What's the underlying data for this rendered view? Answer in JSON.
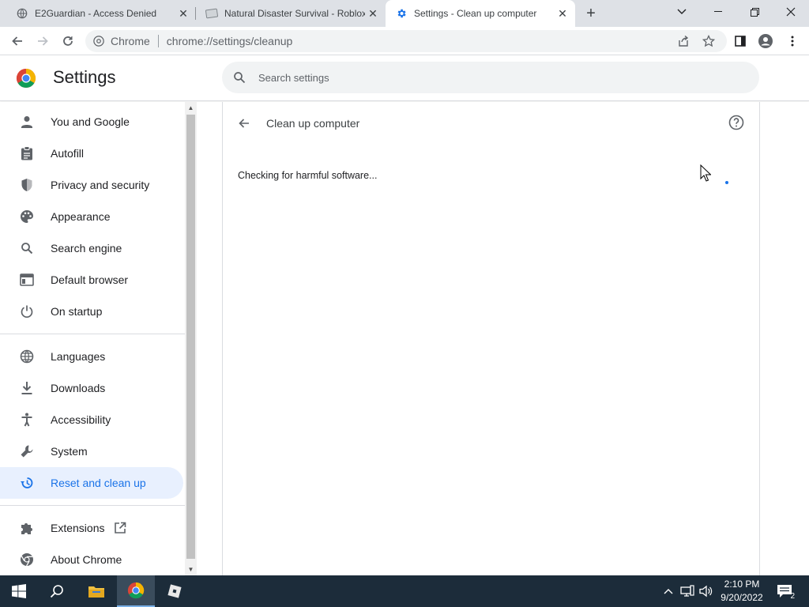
{
  "tabs": [
    {
      "title": "E2Guardian - Access Denied",
      "icon": "globe-icon",
      "active": false
    },
    {
      "title": "Natural Disaster Survival - Roblox",
      "icon": "page-icon",
      "active": false
    },
    {
      "title": "Settings - Clean up computer",
      "icon": "gear-icon",
      "active": true
    }
  ],
  "omnibox": {
    "chip": "Chrome",
    "url": "chrome://settings/cleanup"
  },
  "settings": {
    "title": "Settings",
    "search_placeholder": "Search settings"
  },
  "sidebar": {
    "items": [
      {
        "label": "You and Google",
        "icon": "person-icon"
      },
      {
        "label": "Autofill",
        "icon": "clipboard-icon"
      },
      {
        "label": "Privacy and security",
        "icon": "shield-icon"
      },
      {
        "label": "Appearance",
        "icon": "palette-icon"
      },
      {
        "label": "Search engine",
        "icon": "search-icon"
      },
      {
        "label": "Default browser",
        "icon": "browser-icon"
      },
      {
        "label": "On startup",
        "icon": "power-icon"
      },
      {
        "label": "Languages",
        "icon": "globe-icon"
      },
      {
        "label": "Downloads",
        "icon": "download-icon"
      },
      {
        "label": "Accessibility",
        "icon": "accessibility-icon"
      },
      {
        "label": "System",
        "icon": "wrench-icon"
      },
      {
        "label": "Reset and clean up",
        "icon": "history-icon",
        "selected": true
      },
      {
        "label": "Extensions",
        "icon": "puzzle-icon"
      },
      {
        "label": "About Chrome",
        "icon": "chrome-icon"
      }
    ]
  },
  "main": {
    "page_title": "Clean up computer",
    "status": "Checking for harmful software..."
  },
  "taskbar": {
    "time": "2:10 PM",
    "date": "9/20/2022",
    "notification_count": "2"
  },
  "colors": {
    "accent": "#1a73e8",
    "selected_bg": "#e8f0fe",
    "taskbar": "#1c2c3a"
  }
}
